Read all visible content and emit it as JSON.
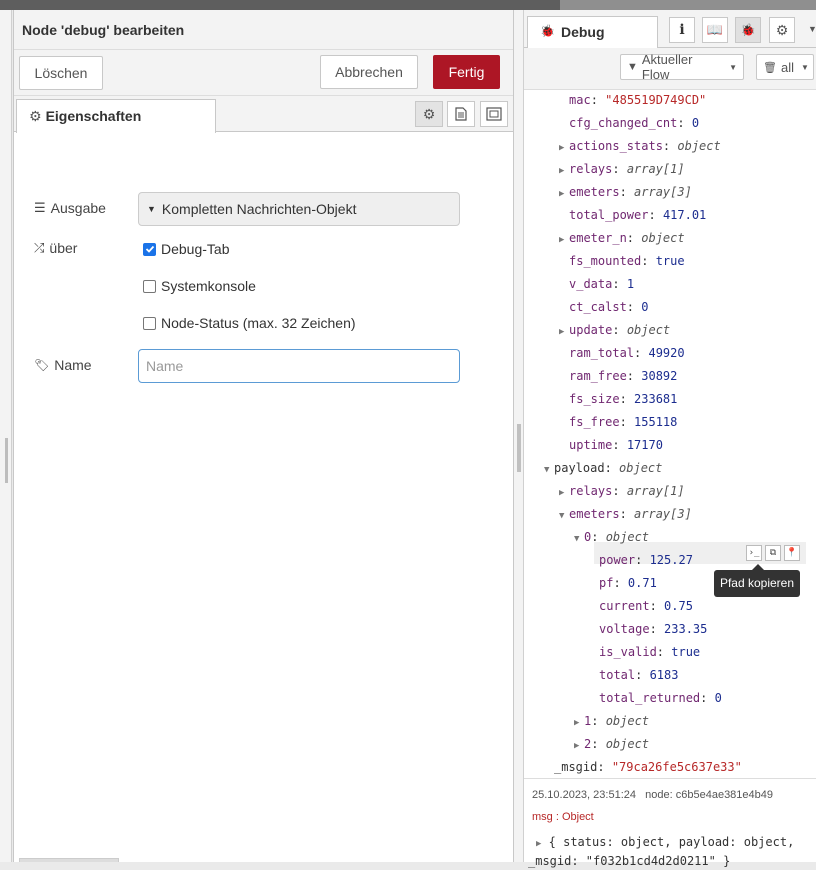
{
  "editor": {
    "title": "Node 'debug' bearbeiten",
    "delete_label": "Löschen",
    "cancel_label": "Abbrechen",
    "done_label": "Fertig",
    "tab_properties": "Eigenschaften",
    "output_label": "Ausgabe",
    "output_value": "Kompletten Nachrichten-Objekt",
    "to_label": "über",
    "debug_tab_label": "Debug-Tab",
    "debug_tab_checked": true,
    "system_console_label": "Systemkonsole",
    "system_console_checked": false,
    "node_status_label": "Node-Status (max. 32 Zeichen)",
    "node_status_checked": false,
    "name_label": "Name",
    "name_placeholder": "Name",
    "name_value": ""
  },
  "debug": {
    "tab_label": "Debug",
    "filter_flow": "Aktueller Flow",
    "filter_all": "all",
    "tree": [
      {
        "k": "mac",
        "v": "\"485519D749CD\"",
        "t": "str",
        "indent": 1,
        "caret": ""
      },
      {
        "k": "cfg_changed_cnt",
        "v": "0",
        "t": "num",
        "indent": 1,
        "caret": ""
      },
      {
        "k": "actions_stats",
        "v": "object",
        "t": "obj",
        "indent": 1,
        "caret": "right"
      },
      {
        "k": "relays",
        "v": "array[1]",
        "t": "obj",
        "indent": 1,
        "caret": "right"
      },
      {
        "k": "emeters",
        "v": "array[3]",
        "t": "obj",
        "indent": 1,
        "caret": "right"
      },
      {
        "k": "total_power",
        "v": "417.01",
        "t": "num",
        "indent": 1,
        "caret": ""
      },
      {
        "k": "emeter_n",
        "v": "object",
        "t": "obj",
        "indent": 1,
        "caret": "right"
      },
      {
        "k": "fs_mounted",
        "v": "true",
        "t": "bool",
        "indent": 1,
        "caret": ""
      },
      {
        "k": "v_data",
        "v": "1",
        "t": "num",
        "indent": 1,
        "caret": ""
      },
      {
        "k": "ct_calst",
        "v": "0",
        "t": "num",
        "indent": 1,
        "caret": ""
      },
      {
        "k": "update",
        "v": "object",
        "t": "obj",
        "indent": 1,
        "caret": "right"
      },
      {
        "k": "ram_total",
        "v": "49920",
        "t": "num",
        "indent": 1,
        "caret": ""
      },
      {
        "k": "ram_free",
        "v": "30892",
        "t": "num",
        "indent": 1,
        "caret": ""
      },
      {
        "k": "fs_size",
        "v": "233681",
        "t": "num",
        "indent": 1,
        "caret": ""
      },
      {
        "k": "fs_free",
        "v": "155118",
        "t": "num",
        "indent": 1,
        "caret": ""
      },
      {
        "k": "uptime",
        "v": "17170",
        "t": "num",
        "indent": 1,
        "caret": ""
      },
      {
        "k": "payload",
        "v": "object",
        "t": "obj",
        "indent": 0,
        "caret": "down"
      },
      {
        "k": "relays",
        "v": "array[1]",
        "t": "obj",
        "indent": 1,
        "caret": "right"
      },
      {
        "k": "emeters",
        "v": "array[3]",
        "t": "obj",
        "indent": 1,
        "caret": "down"
      },
      {
        "k": "0",
        "v": "object",
        "t": "obj",
        "indent": 2,
        "caret": "down"
      },
      {
        "k": "power",
        "v": "125.27",
        "t": "num",
        "indent": 3,
        "caret": ""
      },
      {
        "k": "pf",
        "v": "0.71",
        "t": "num",
        "indent": 3,
        "caret": ""
      },
      {
        "k": "current",
        "v": "0.75",
        "t": "num",
        "indent": 3,
        "caret": ""
      },
      {
        "k": "voltage",
        "v": "233.35",
        "t": "num",
        "indent": 3,
        "caret": ""
      },
      {
        "k": "is_valid",
        "v": "true",
        "t": "bool",
        "indent": 3,
        "caret": ""
      },
      {
        "k": "total",
        "v": "6183",
        "t": "num",
        "indent": 3,
        "caret": ""
      },
      {
        "k": "total_returned",
        "v": "0",
        "t": "num",
        "indent": 3,
        "caret": ""
      },
      {
        "k": "1",
        "v": "object",
        "t": "obj",
        "indent": 2,
        "caret": "right"
      },
      {
        "k": "2",
        "v": "object",
        "t": "obj",
        "indent": 2,
        "caret": "right"
      },
      {
        "k": "_msgid",
        "v": "\"79ca26fe5c637e33\"",
        "t": "str",
        "indent": 0,
        "caret": ""
      }
    ],
    "tooltip": "Pfad kopieren",
    "meta_time": "25.10.2023, 23:51:24",
    "meta_node": "node: c6b5e4ae381e4b49",
    "meta_type": "msg : Object",
    "summary_line1": "{ status: object, payload: object,",
    "summary_line2": "_msgid: \"f032b1cd4d2d0211\" }"
  }
}
